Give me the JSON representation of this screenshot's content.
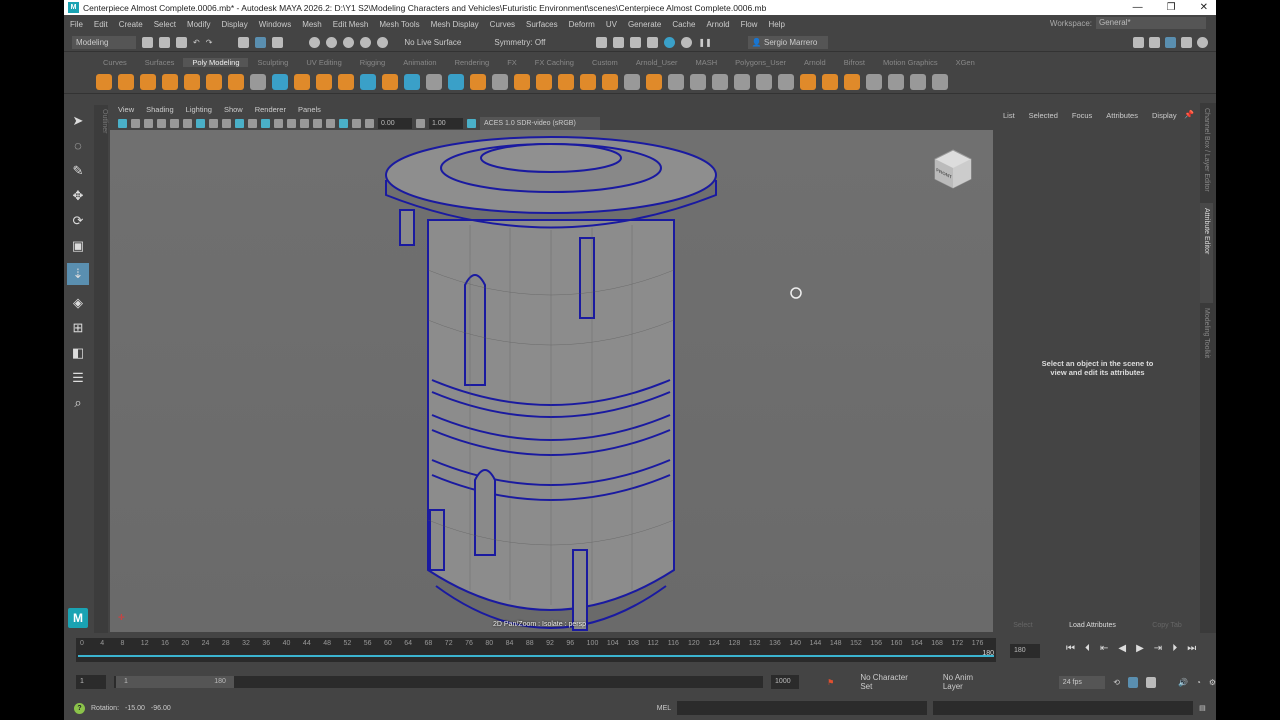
{
  "window": {
    "title": "Centerpiece Almost Complete.0006.mb* - Autodesk MAYA 2026.2: D:\\Y1 S2\\Modeling Characters and Vehicles\\Futuristic Environment\\scenes\\Centerpiece Almost Complete.0006.mb",
    "minimize": "—",
    "restore": "❐",
    "close": "✕"
  },
  "menu": [
    "File",
    "Edit",
    "Create",
    "Select",
    "Modify",
    "Display",
    "Windows",
    "Mesh",
    "Edit Mesh",
    "Mesh Tools",
    "Mesh Display",
    "Curves",
    "Surfaces",
    "Deform",
    "UV",
    "Generate",
    "Cache",
    "Arnold",
    "Flow",
    "Help"
  ],
  "workspace": {
    "label": "Workspace:",
    "value": "General*"
  },
  "status": {
    "menuset": "Modeling",
    "live_surface": "No Live Surface",
    "symmetry": "Symmetry: Off",
    "user": "Sergio Marrero"
  },
  "shelf_tabs": [
    "Curves",
    "Surfaces",
    "Poly Modeling",
    "Sculpting",
    "UV Editing",
    "Rigging",
    "Animation",
    "Rendering",
    "FX",
    "FX Caching",
    "Custom",
    "Arnold_User",
    "MASH",
    "Polygons_User",
    "Arnold",
    "Bifrost",
    "Motion Graphics",
    "XGen"
  ],
  "shelf_active": "Poly Modeling",
  "outliner_tab": "Outliner",
  "panel_menu": [
    "View",
    "Shading",
    "Lighting",
    "Show",
    "Renderer",
    "Panels"
  ],
  "panel_tools": {
    "exposure": "0.00",
    "gamma": "1.00",
    "colorspace": "ACES 1.0 SDR-video (sRGB)"
  },
  "viewport": {
    "hud": "2D Pan/Zoom : Isolate : persp",
    "viewcube": "FRONT"
  },
  "attribute_editor": {
    "tabs": [
      "List",
      "Selected",
      "Focus",
      "Attributes",
      "Display"
    ],
    "message_line1": "Select an object in the scene to",
    "message_line2": "view and edit its attributes",
    "buttons": [
      "Select",
      "Load Attributes",
      "Copy Tab"
    ]
  },
  "side_tabs": [
    "Channel Box / Layer Editor",
    "Attribute Editor",
    "Modeling Toolkit"
  ],
  "timeline": {
    "ticks": [
      "0",
      "4",
      "8",
      "12",
      "16",
      "20",
      "24",
      "28",
      "32",
      "36",
      "40",
      "44",
      "48",
      "52",
      "56",
      "60",
      "64",
      "68",
      "72",
      "76",
      "80",
      "84",
      "88",
      "92",
      "96",
      "100",
      "104",
      "108",
      "112",
      "116",
      "120",
      "124",
      "128",
      "132",
      "136",
      "140",
      "144",
      "148",
      "152",
      "156",
      "160",
      "164",
      "168",
      "172",
      "176"
    ],
    "end_marker": "180",
    "current_frame": "180"
  },
  "range": {
    "start": "1",
    "range_start": "1",
    "range_end": "180",
    "end": "1000",
    "character_set": "No Character Set",
    "anim_layer": "No Anim Layer",
    "fps": "24 fps"
  },
  "command": {
    "feedback_label": "Rotation:",
    "rot_x": "-15.00",
    "rot_y": "-96.00",
    "lang": "MEL"
  }
}
